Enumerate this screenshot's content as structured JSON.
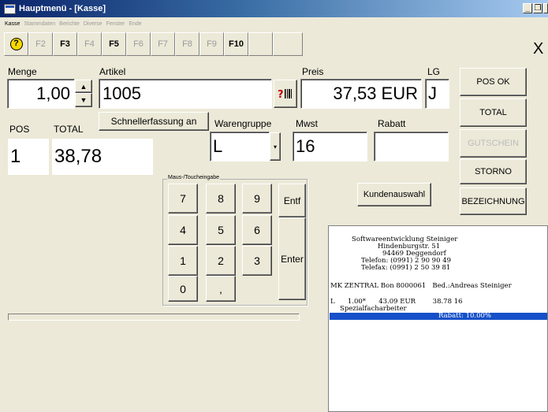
{
  "window": {
    "title": "Hauptmenü - [Kasse]",
    "controls": {
      "minimize": "_",
      "restore": "❐",
      "close": "×"
    }
  },
  "menu": [
    "Kasse",
    "Stammdaten",
    "Berichte",
    "Diverse",
    "Fenster",
    "Ende"
  ],
  "fkeys": [
    {
      "label": "F2",
      "enabled": false
    },
    {
      "label": "F3",
      "enabled": true
    },
    {
      "label": "F4",
      "enabled": false
    },
    {
      "label": "F5",
      "enabled": true
    },
    {
      "label": "F6",
      "enabled": false
    },
    {
      "label": "F7",
      "enabled": false
    },
    {
      "label": "F8",
      "enabled": false
    },
    {
      "label": "F9",
      "enabled": false
    },
    {
      "label": "F10",
      "enabled": true
    }
  ],
  "help_glyph": "?",
  "close_x": "X",
  "menge": {
    "label": "Menge",
    "value": "1,00"
  },
  "artikel": {
    "label": "Artikel",
    "value": "1005"
  },
  "preis": {
    "label": "Preis",
    "value": "37,53 EUR"
  },
  "lg": {
    "label": "LG",
    "value": "J"
  },
  "pos": {
    "label": "POS",
    "value": "1"
  },
  "total": {
    "label": "TOTAL",
    "value": "38,78"
  },
  "schnellerfassung_label": "Schnellerfassung an",
  "warengruppe": {
    "label": "Warengruppe",
    "value": "L"
  },
  "mwst": {
    "label": "Mwst",
    "value": "16"
  },
  "rabatt": {
    "label": "Rabatt",
    "value": ""
  },
  "numpad": {
    "title": "Maus-/Toucheingabe",
    "keys": [
      "7",
      "8",
      "9",
      "4",
      "5",
      "6",
      "1",
      "2",
      "3",
      "0",
      ","
    ],
    "entf": "Entf",
    "enter": "Enter"
  },
  "kundenauswahl_label": "Kundenauswahl",
  "side_buttons": [
    {
      "label": "POS OK",
      "enabled": true
    },
    {
      "label": "TOTAL",
      "enabled": true
    },
    {
      "label": "GUTSCHEIN",
      "enabled": false
    },
    {
      "label": "STORNO",
      "enabled": true
    },
    {
      "label": "BEZEICHNUNG",
      "enabled": true
    }
  ],
  "receipt": {
    "header": [
      "Softwareentwicklung Steiniger",
      "Hindenburgstr. 51",
      "94469 Deggendorf",
      "Telefon: (0991) 2 90 90 49",
      "Telefax: (0991) 2 50 39 81"
    ],
    "bon_line": "MK ZENTRAL Bon 8000061   Bed.:Andreas Steiniger",
    "item_line": "L      1.00*      43.09 EUR        38.78 16",
    "item_desc": "Spezialfacharbeiter",
    "rabatt_line": "Rabatt: 10.00%"
  },
  "colors": {
    "window_bg": "#ece9d8",
    "title_bar": "#0a246a",
    "highlight": "#1650c8"
  }
}
